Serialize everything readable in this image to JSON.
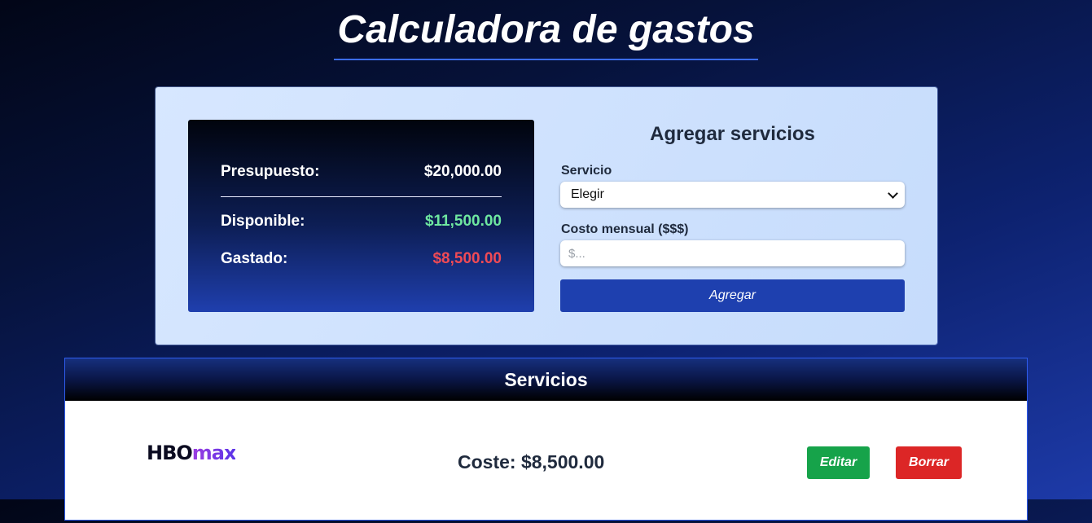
{
  "page": {
    "title": "Calculadora de gastos"
  },
  "budget": {
    "presupuesto_label": "Presupuesto:",
    "presupuesto_value": "$20,000.00",
    "disponible_label": "Disponible:",
    "disponible_value": "$11,500.00",
    "gastado_label": "Gastado:",
    "gastado_value": "$8,500.00"
  },
  "form": {
    "title": "Agregar servicios",
    "service_label": "Servicio",
    "service_selected": "Elegir",
    "cost_label": "Costo mensual ($$$)",
    "cost_placeholder": "$...",
    "cost_value": "",
    "add_label": "Agregar"
  },
  "services": {
    "title": "Servicios",
    "items": [
      {
        "logo_hbo": "HBO",
        "logo_max": "max",
        "cost": "Coste: $8,500.00",
        "edit_label": "Editar",
        "delete_label": "Borrar"
      }
    ]
  },
  "colors": {
    "available": "#6ee7a0",
    "spent": "#f04a55",
    "primary": "#1e40af",
    "edit": "#16a34a",
    "delete": "#dc2626"
  }
}
